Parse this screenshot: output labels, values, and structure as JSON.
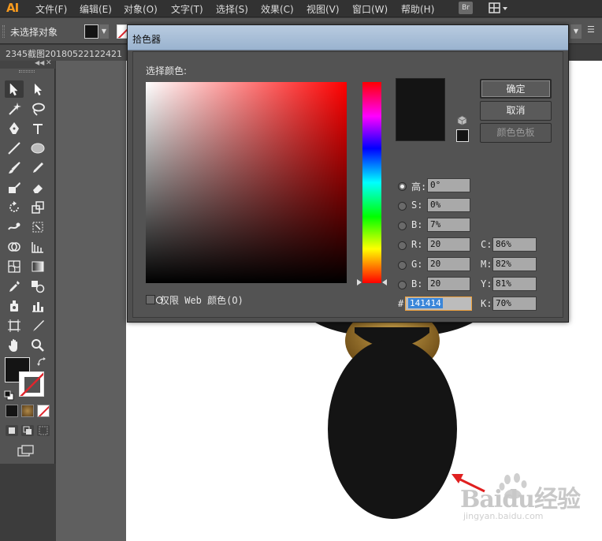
{
  "app": {
    "logo": "AI"
  },
  "menubar": {
    "items": [
      "文件(F)",
      "编辑(E)",
      "对象(O)",
      "文字(T)",
      "选择(S)",
      "效果(C)",
      "视图(V)",
      "窗口(W)",
      "帮助(H)"
    ],
    "bridge_label": "Br"
  },
  "controlbar": {
    "selection_status": "未选择对象",
    "fill_color": "#141414"
  },
  "document": {
    "tab_title": "2345截图20180522122421"
  },
  "color_picker": {
    "title": "拾色器",
    "select_label": "选择颜色:",
    "buttons": {
      "ok": "确定",
      "cancel": "取消",
      "swatches": "颜色色板"
    },
    "hsb": {
      "h_label": "高:",
      "h_value": "0°",
      "s_label": "S:",
      "s_value": "0%",
      "b_label": "B:",
      "b_value": "7%"
    },
    "rgb": {
      "r_label": "R:",
      "r_value": "20",
      "g_label": "G:",
      "g_value": "20",
      "b_label": "B:",
      "b_value": "20"
    },
    "cmyk": {
      "c_label": "C:",
      "c_value": "86%",
      "m_label": "M:",
      "m_value": "82%",
      "y_label": "Y:",
      "y_value": "81%",
      "k_label": "K:",
      "k_value": "70%"
    },
    "hex_label": "#",
    "hex_value": "141414",
    "web_only_label": "仅限 Web 颜色(O)",
    "selected_color": "#141414",
    "hue_color": "#ff0000"
  },
  "watermark": {
    "brand": "Baidu经验",
    "url": "jingyan.baidu.com"
  },
  "colors": {
    "accent_orange": "#f79a1e",
    "arrow_red": "#e02020",
    "hex_selection": "#3a86d9"
  }
}
